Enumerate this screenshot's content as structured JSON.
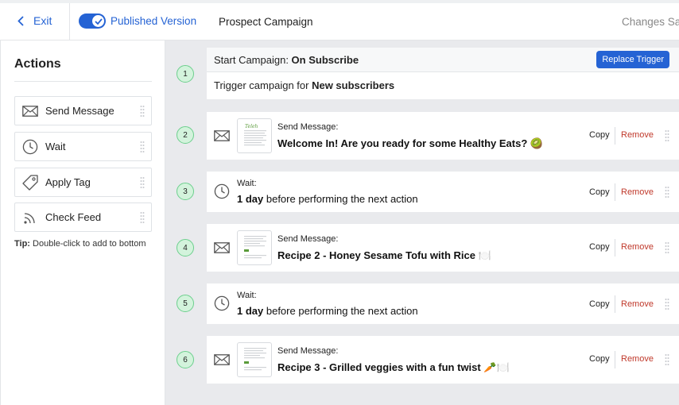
{
  "header": {
    "exit_label": "Exit",
    "published_label": "Published Version",
    "campaign_title": "Prospect Campaign",
    "status_text": "Changes Sav",
    "toggle_on": true
  },
  "sidebar": {
    "title": "Actions",
    "items": [
      {
        "label": "Send Message",
        "icon": "envelope-icon"
      },
      {
        "label": "Wait",
        "icon": "clock-icon"
      },
      {
        "label": "Apply Tag",
        "icon": "tag-icon"
      },
      {
        "label": "Check Feed",
        "icon": "rss-icon"
      }
    ],
    "tip_bold": "Tip:",
    "tip_text": " Double-click to add to bottom"
  },
  "trigger": {
    "step": "1",
    "head_prefix": "Start Campaign: ",
    "head_value": "On Subscribe",
    "replace_label": "Replace Trigger",
    "body_prefix": "Trigger campaign for ",
    "body_value": "New subscribers"
  },
  "steps": [
    {
      "step": "2",
      "type": "message",
      "label": "Send Message:",
      "title": "Welcome In! Are you ready for some Healthy Eats? 🥝",
      "copy": "Copy",
      "remove": "Remove"
    },
    {
      "step": "3",
      "type": "wait",
      "label": "Wait:",
      "title_bold": "1 day",
      "title_rest": " before performing the next action",
      "copy": "Copy",
      "remove": "Remove"
    },
    {
      "step": "4",
      "type": "message",
      "label": "Send Message:",
      "title": "Recipe 2 - Honey Sesame Tofu with Rice 🍽️",
      "copy": "Copy",
      "remove": "Remove"
    },
    {
      "step": "5",
      "type": "wait",
      "label": "Wait:",
      "title_bold": "1 day",
      "title_rest": " before performing the next action",
      "copy": "Copy",
      "remove": "Remove"
    },
    {
      "step": "6",
      "type": "message",
      "label": "Send Message:",
      "title": "Recipe 3 - Grilled veggies with a fun twist 🥕🍽️",
      "copy": "Copy",
      "remove": "Remove"
    }
  ],
  "colors": {
    "accent": "#2563d4",
    "remove": "#c0392b",
    "step_badge": "#d3f3dc",
    "step_border": "#6ccf8d"
  }
}
